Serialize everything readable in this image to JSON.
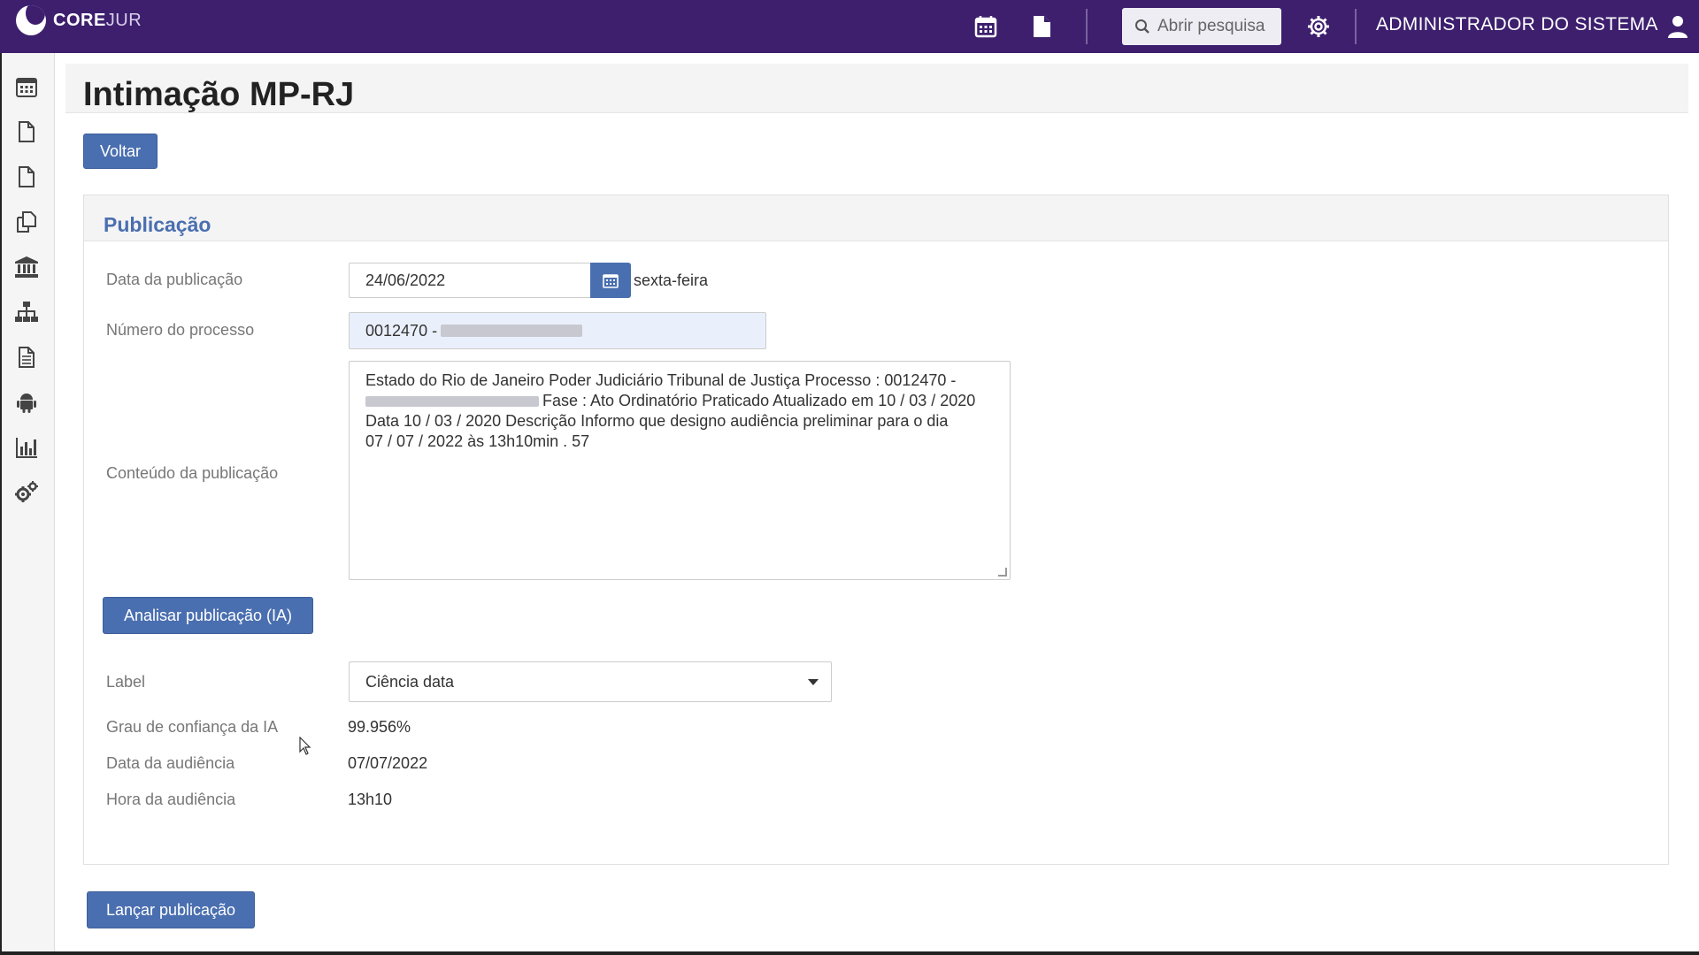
{
  "app": {
    "logo_core": "CORE",
    "logo_jur": "JUR",
    "search_label": "Abrir pesquisa",
    "user_name": "ADMINISTRADOR DO SISTEMA"
  },
  "topbar_icons": [
    "calendar-icon",
    "document-icon",
    "search-icon",
    "gear-icon",
    "user-icon"
  ],
  "sidebar": {
    "items": [
      {
        "icon": "calendar-icon"
      },
      {
        "icon": "file-icon"
      },
      {
        "icon": "file-icon"
      },
      {
        "icon": "copy-icon"
      },
      {
        "icon": "bank-icon"
      },
      {
        "icon": "sitemap-icon"
      },
      {
        "icon": "file-text-icon"
      },
      {
        "icon": "android-icon"
      },
      {
        "icon": "bar-chart-icon"
      },
      {
        "icon": "gears-icon"
      }
    ]
  },
  "page": {
    "title": "Intimação MP-RJ",
    "back_button": "Voltar"
  },
  "publicacao": {
    "section_title": "Publicação",
    "data_label": "Data da publicação",
    "data_value": "24/06/2022",
    "weekday": "sexta-feira",
    "processo_label": "Número do processo",
    "processo_value": "0012470 -",
    "conteudo_label": "Conteúdo da publicação",
    "conteudo_line1": "Estado do Rio de Janeiro Poder Judiciário Tribunal de Justiça Processo : 0012470 -",
    "conteudo_line2": "Fase : Ato Ordinatório Praticado Atualizado em 10 / 03 / 2020",
    "conteudo_line3": "Data 10 / 03 / 2020 Descrição Informo que designo audiência preliminar para o dia",
    "conteudo_line4": "07 / 07 / 2022 às 13h10min . 57",
    "analisar_button": "Analisar publicação (IA)",
    "label_label": "Label",
    "label_value": "Ciência data",
    "confianca_label": "Grau de confiança da IA",
    "confianca_value": "99.956%",
    "audiencia_data_label": "Data da audiência",
    "audiencia_data_value": "07/07/2022",
    "audiencia_hora_label": "Hora da audiência",
    "audiencia_hora_value": "13h10"
  },
  "lancar_button": "Lançar publicação",
  "colors": {
    "topbar": "#3d1f6e",
    "primary": "#4a6fb0",
    "section_title": "#4a6fb0"
  }
}
